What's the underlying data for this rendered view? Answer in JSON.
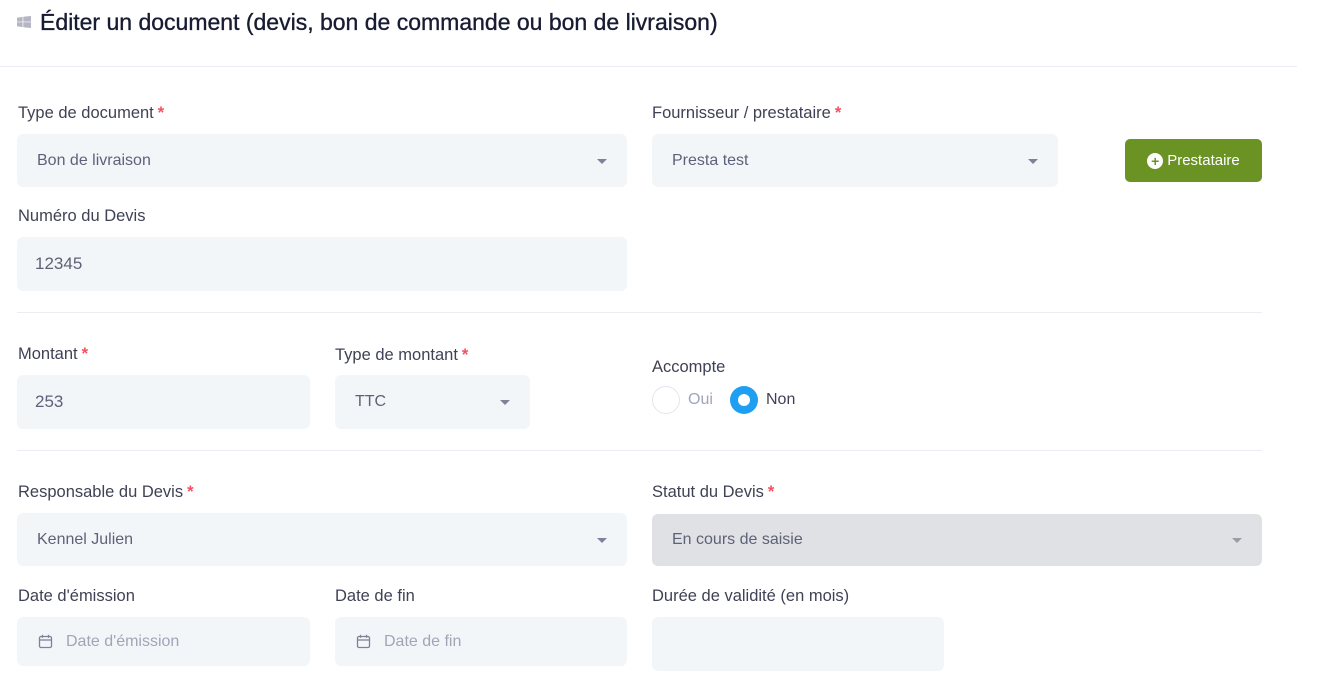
{
  "header": {
    "title": "Éditer un document (devis, bon de commande ou bon de livraison)",
    "icon": "windows-icon"
  },
  "required_marker": "*",
  "colors": {
    "accent": "#6a9323",
    "radio_active": "#1e9ff2",
    "required": "#f64e60",
    "field_bg": "#f3f6f9"
  },
  "document_type": {
    "label": "Type de document",
    "value": "Bon de livraison"
  },
  "provider": {
    "label": "Fournisseur / prestataire",
    "value": "Presta test",
    "add_button_label": "Prestataire"
  },
  "quote_number": {
    "label": "Numéro du Devis",
    "value": "12345"
  },
  "amount": {
    "label": "Montant",
    "value": "253"
  },
  "amount_type": {
    "label": "Type de montant",
    "value": "TTC"
  },
  "deposit": {
    "label": "Accompte",
    "options": [
      {
        "label": "Oui",
        "selected": false
      },
      {
        "label": "Non",
        "selected": true
      }
    ]
  },
  "quote_manager": {
    "label": "Responsable du Devis",
    "value": "Kennel Julien"
  },
  "quote_status": {
    "label": "Statut du Devis",
    "value": "En cours de saisie",
    "disabled": true
  },
  "issue_date": {
    "label": "Date d'émission",
    "placeholder": "Date d'émission",
    "icon": "calendar-icon"
  },
  "end_date": {
    "label": "Date de fin",
    "placeholder": "Date de fin",
    "icon": "calendar-icon"
  },
  "validity": {
    "label": "Durée de validité (en mois)",
    "value": ""
  }
}
